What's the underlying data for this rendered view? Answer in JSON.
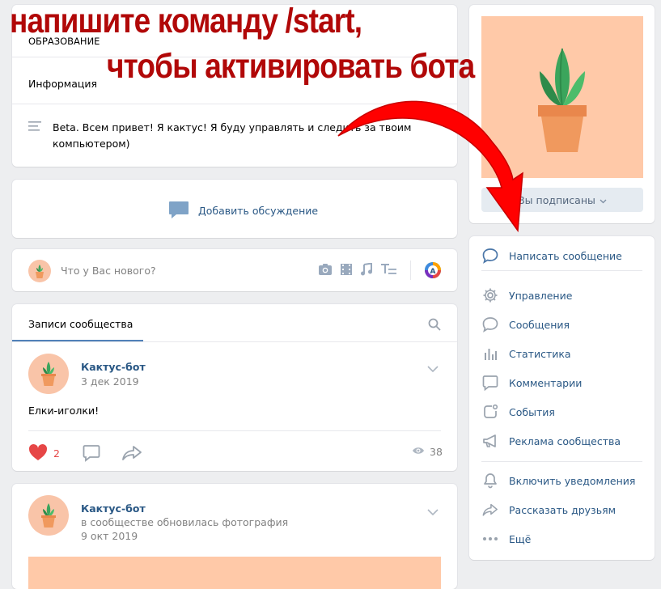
{
  "overlay": {
    "line1": "напишите команду /start,",
    "line2": "чтобы активировать бота"
  },
  "info": {
    "category_value": "ОБРАЗОВАНИЕ",
    "info_label": "Информация",
    "description": "Beta. Всем привет! Я кактус! Я буду управлять и следить за твоим",
    "description2": "компьютером)"
  },
  "discussion": {
    "add_label": "Добавить обсуждение"
  },
  "new_post": {
    "placeholder": "Что у Вас нового?"
  },
  "posts_tab": {
    "label": "Записи сообщества"
  },
  "post1": {
    "author": "Кактус-бот",
    "date": "3 дек 2019",
    "text": "Елки-иголки!",
    "likes": "2",
    "views": "38"
  },
  "post2": {
    "author": "Кактус-бот",
    "subtitle": "в сообществе обновилась фотография",
    "date": "9 окт 2019"
  },
  "sidebar": {
    "subscribed_label": "Вы подписаны",
    "menu": [
      {
        "label": "Написать сообщение",
        "icon": "message-bubble-icon"
      },
      {
        "label": "Управление",
        "icon": "gear-icon"
      },
      {
        "label": "Сообщения",
        "icon": "chat-icon"
      },
      {
        "label": "Статистика",
        "icon": "stats-icon"
      },
      {
        "label": "Комментарии",
        "icon": "comment-icon"
      },
      {
        "label": "События",
        "icon": "events-icon"
      },
      {
        "label": "Реклама сообщества",
        "icon": "megaphone-icon"
      },
      {
        "label": "Включить уведомления",
        "icon": "bell-icon"
      },
      {
        "label": "Рассказать друзьям",
        "icon": "share-icon"
      },
      {
        "label": "Ещё",
        "icon": "more-dots-icon"
      }
    ]
  },
  "colors": {
    "accent": "#2a5885",
    "overlay_red": "#b10808",
    "arrow_red": "#ff0000",
    "like_red": "#e64646",
    "avatar_peach": "#f9c4a8"
  }
}
